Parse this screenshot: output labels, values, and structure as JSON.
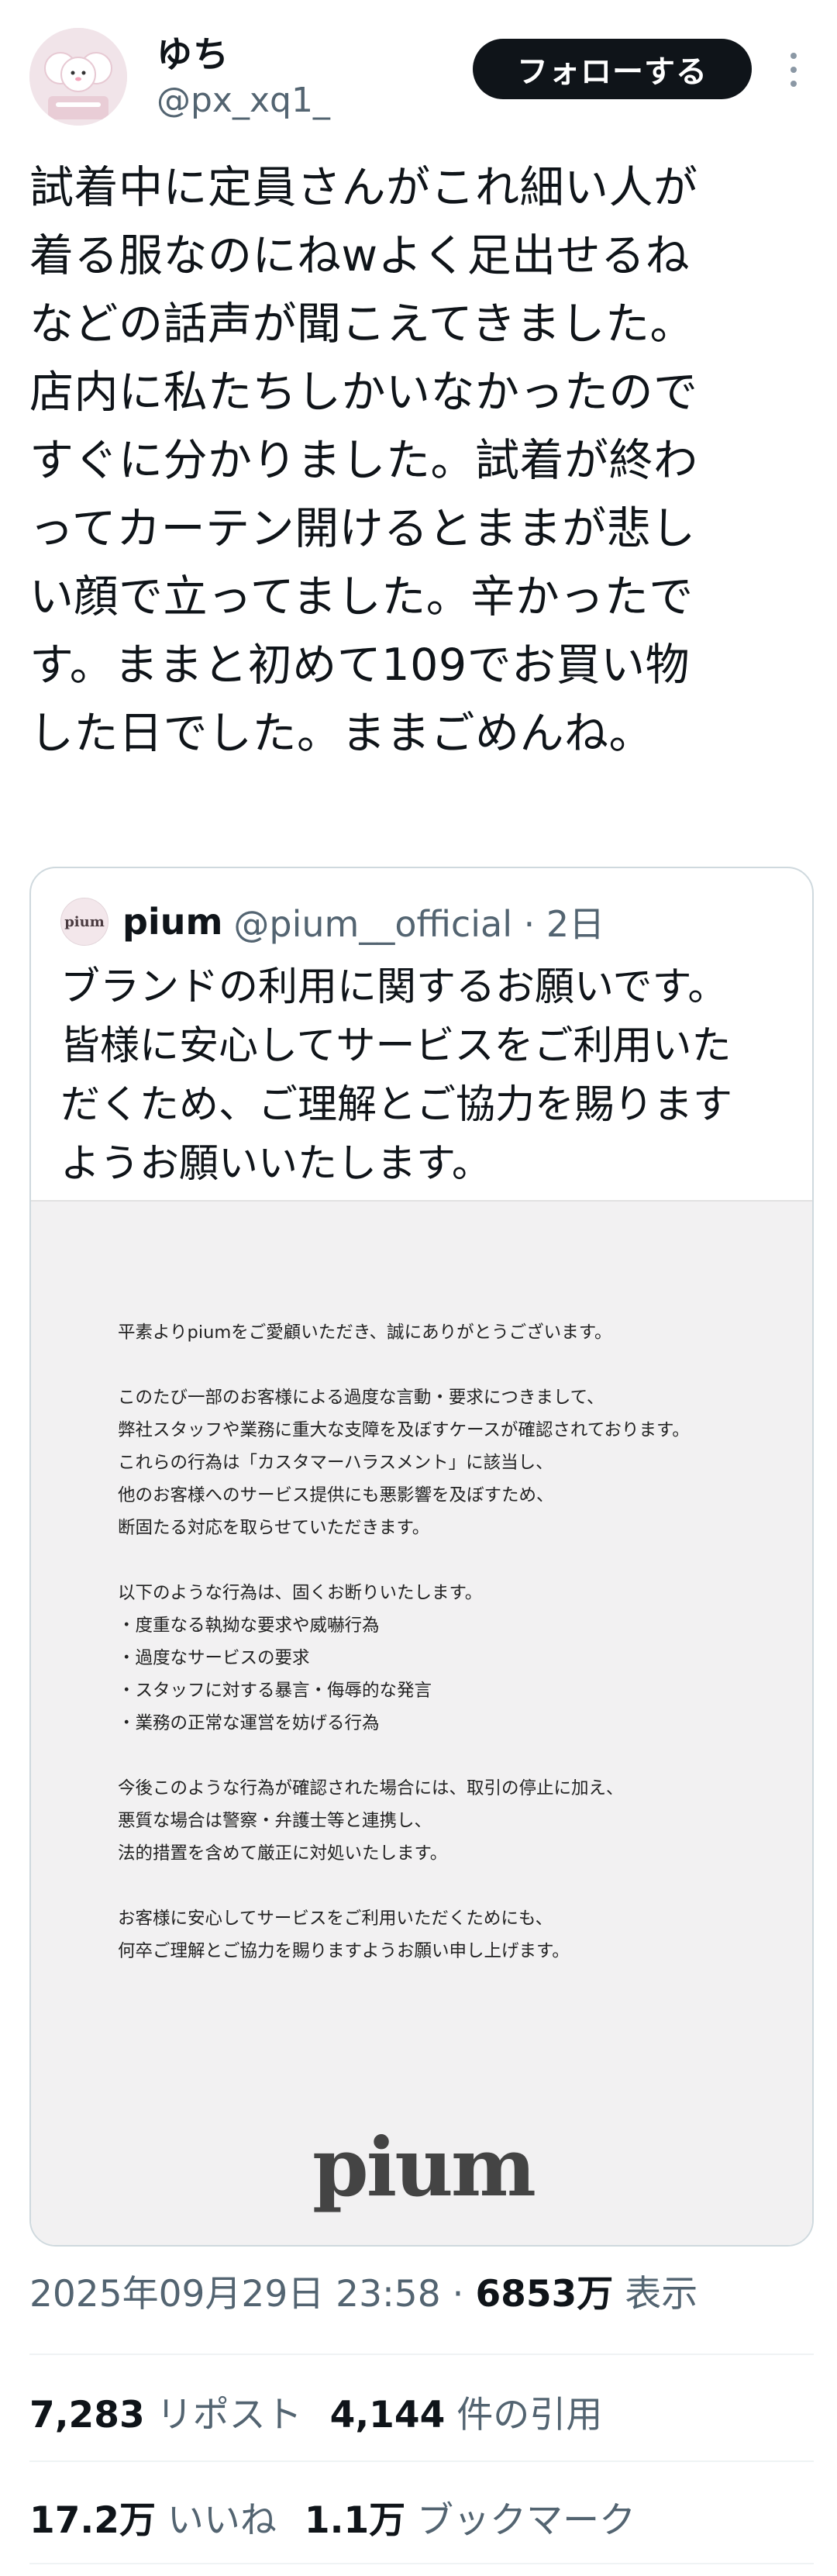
{
  "user": {
    "display_name": "ゆち",
    "handle": "@px_xq1_"
  },
  "follow_label": "フォローする",
  "tweet_text": "試着中に定員さんがこれ細い人が\n着る服なのにねwよく足出せるね\nなどの話声が聞こえてきました。\n店内に私たちしかいなかったので\nすぐに分かりました。試着が終わ\nってカーテン開けるとままが悲し\nい顔で立ってました。辛かったで\nす。ままと初めて109でお買い物\nした日でした。ままごめんね。",
  "quote": {
    "avatar_text": "pium",
    "name": "pium",
    "handle_time": "@pium__official · 2日",
    "text": "ブランドの利用に関するお願いです。\n皆様に安心してサービスをご利用いた\nだくため、ご理解とご協力を賜ります\nようお願いいたします。",
    "notice_body": "平素よりpiumをご愛顧いただき、誠にありがとうございます。\n\nこのたび一部のお客様による過度な言動・要求につきまして、\n弊社スタッフや業務に重大な支障を及ぼすケースが確認されております。\nこれらの行為は「カスタマーハラスメント」に該当し、\n他のお客様へのサービス提供にも悪影響を及ぼすため、\n断固たる対応を取らせていただきます。\n\n以下のような行為は、固くお断りいたします。\n・度重なる執拗な要求や威嚇行為\n・過度なサービスの要求\n・スタッフに対する暴言・侮辱的な発言\n・業務の正常な運営を妨げる行為\n\n今後このような行為が確認された場合には、取引の停止に加え、\n悪質な場合は警察・弁護士等と連携し、\n法的措置を含めて厳正に対処いたします。\n\nお客様に安心してサービスをご利用いただくためにも、\n何卒ご理解とご協力を賜りますようお願い申し上げます。",
    "logo_text": "pium"
  },
  "meta": {
    "timestamp": "2025年09月29日 23:58 · ",
    "views_count": "6853万",
    "views_label": " 表示"
  },
  "stats": {
    "reposts_count": "7,283",
    "reposts_label": "リポスト",
    "quotes_count": "4,144",
    "quotes_label": "件の引用",
    "likes_count": "17.2万",
    "likes_label": "いいね",
    "bookmarks_count": "1.1万",
    "bookmarks_label": "ブックマーク"
  }
}
